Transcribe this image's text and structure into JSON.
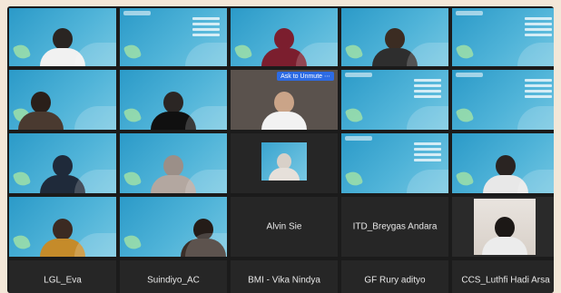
{
  "ask_to_unmute": "Ask to Unmute",
  "more_glyph": "⋯",
  "participants": [
    {
      "name": "Alvin Sie"
    },
    {
      "name": "ITD_Breygas Andara"
    },
    {
      "name": "LGL_Eva"
    },
    {
      "name": "Suindiyo_AC"
    },
    {
      "name": "BMI - Vika Nindya"
    },
    {
      "name": "GF Rury adityo"
    },
    {
      "name": "CCS_Luthfi Hadi Arsa"
    }
  ],
  "colors": {
    "accent": "#2d6be4",
    "slide_blue": "#2b9ac8",
    "tile_bg": "#262626"
  }
}
